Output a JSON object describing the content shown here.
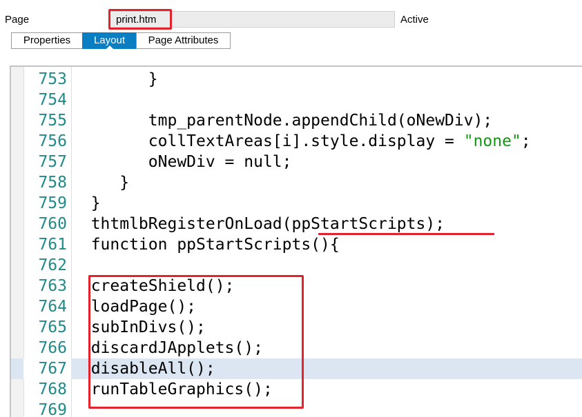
{
  "header": {
    "page_label": "Page",
    "page_value": "print.htm",
    "status": "Active"
  },
  "tabs": [
    {
      "label": "Properties",
      "active": false
    },
    {
      "label": "Layout",
      "active": true
    },
    {
      "label": "Page Attributes",
      "active": false
    }
  ],
  "colors": {
    "accent": "#0a7ec2",
    "highlight": "#e3232b",
    "line_number": "#1e8a8a",
    "string": "#109910",
    "current_line": "#dce6f2"
  },
  "code": {
    "current_line": "767",
    "lines": [
      {
        "number": "753",
        "text": "        }"
      },
      {
        "number": "754",
        "text": ""
      },
      {
        "number": "755",
        "text": "        tmp_parentNode.appendChild(oNewDiv);"
      },
      {
        "number": "756",
        "text": "        collTextAreas[i].style.display = ",
        "string": "\"none\"",
        "after": ";"
      },
      {
        "number": "757",
        "text": "        oNewDiv = null;"
      },
      {
        "number": "758",
        "text": "     }"
      },
      {
        "number": "759",
        "text": "  }"
      },
      {
        "number": "760",
        "text": "  thtmlbRegisterOnLoad(ppStartScripts);"
      },
      {
        "number": "761",
        "text": "  function ppStartScripts(){"
      },
      {
        "number": "762",
        "text": ""
      },
      {
        "number": "763",
        "text": "  createShield();"
      },
      {
        "number": "764",
        "text": "  loadPage();"
      },
      {
        "number": "765",
        "text": "  subInDivs();"
      },
      {
        "number": "766",
        "text": "  discardJApplets();"
      },
      {
        "number": "767",
        "text": "  disableAll();"
      },
      {
        "number": "768",
        "text": "  runTableGraphics();"
      },
      {
        "number": "769",
        "text": ""
      }
    ]
  }
}
